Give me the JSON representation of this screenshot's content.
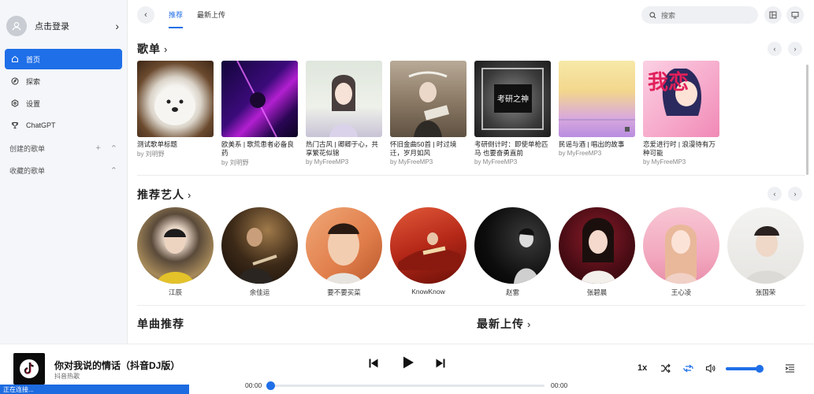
{
  "sidebar": {
    "login_label": "点击登录",
    "nav": [
      {
        "label": "首页",
        "icon": "home-icon",
        "active": true
      },
      {
        "label": "探索",
        "icon": "compass-icon",
        "active": false
      },
      {
        "label": "设置",
        "icon": "settings-icon",
        "active": false
      },
      {
        "label": "ChatGPT",
        "icon": "trophy-icon",
        "active": false
      }
    ],
    "created_playlists_label": "创建的歌单",
    "favorite_playlists_label": "收藏的歌单"
  },
  "topbar": {
    "tabs": [
      {
        "label": "推荐",
        "active": true
      },
      {
        "label": "最新上传",
        "active": false
      }
    ],
    "search_placeholder": "搜索"
  },
  "sections": {
    "playlists_title": "歌单",
    "artists_title": "推荐艺人",
    "singles_title": "单曲推荐",
    "latest_title": "最新上传"
  },
  "playlists": [
    {
      "title": "测试歌单标题",
      "by": "by 刘明野"
    },
    {
      "title": "欧美系 | 歌荒患者必备良药",
      "by": "by 刘明野"
    },
    {
      "title": "热门古风 | 卿卿于心，共享繁花似锦",
      "by": "by MyFreeMP3"
    },
    {
      "title": "怀旧金曲50首 | 时过境迁，岁月如风",
      "by": "by MyFreeMP3"
    },
    {
      "title": "考研倒计时：即使单枪匹马 也要奋勇直前",
      "by": "by MyFreeMP3"
    },
    {
      "title": "民谣与酒 | 唱出的故事",
      "by": "by MyFreeMP3"
    },
    {
      "title": "恋爱进行时 | 浪漫待有万种可能",
      "by": "by MyFreeMP3"
    }
  ],
  "playlist_cover_texts": {
    "kaoyan": "考研之神",
    "love": "我恋"
  },
  "artists": [
    {
      "name": "江辰"
    },
    {
      "name": "余佳运"
    },
    {
      "name": "要不要买菜"
    },
    {
      "name": "KnowKnow"
    },
    {
      "name": "赵雷"
    },
    {
      "name": "张碧晨"
    },
    {
      "name": "王心凌"
    },
    {
      "name": "张国荣"
    }
  ],
  "player": {
    "title": "你对我说的情话（抖音DJ版）",
    "artist": "抖音热歌",
    "current_time": "00:00",
    "total_time": "00:00",
    "rate": "1x",
    "progress": 0,
    "volume": 0.85,
    "status_text": "正在连接..."
  },
  "colors": {
    "accent": "#1f6fe8",
    "sidebar_bg": "#f4f6f9"
  }
}
